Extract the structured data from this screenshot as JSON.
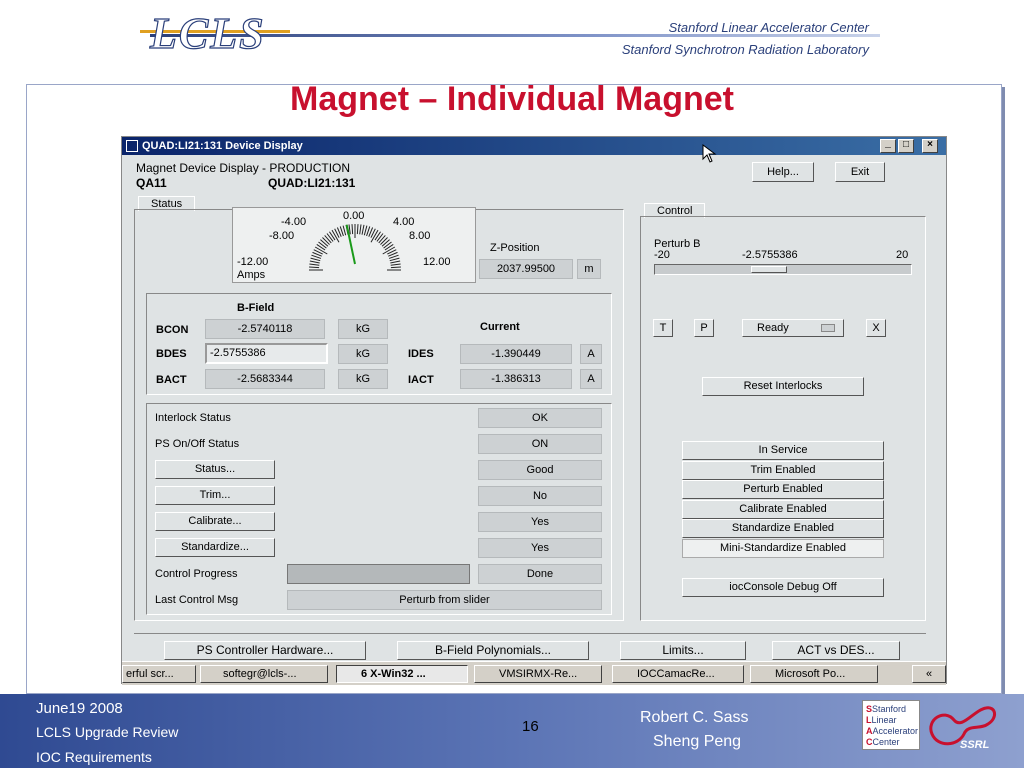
{
  "header": {
    "logo": "LCLS",
    "org1": "Stanford Linear Accelerator Center",
    "org2": "Stanford Synchrotron Radiation Laboratory"
  },
  "slide_title": "Magnet – Individual Magnet",
  "window": {
    "title": "QUAD:LI21:131 Device Display",
    "minimize": "_",
    "maximize": "□",
    "close": "×",
    "subtitle": "Magnet Device Display  -  PRODUCTION",
    "device_short": "QA11",
    "device_name": "QUAD:LI21:131",
    "help_button": "Help...",
    "exit_button": "Exit"
  },
  "status_tab": {
    "tab_label": "Status",
    "meter": {
      "ticks": [
        "-4.00",
        "0.00",
        "4.00",
        "-8.00",
        "8.00",
        "-12.00",
        "12.00"
      ],
      "units": "Amps",
      "needle_value": -1.39
    },
    "z_position_label": "Z-Position",
    "z_position_value": "2037.99500",
    "z_position_unit": "m",
    "bfield_title": "B-Field",
    "current_title": "Current",
    "bcon_label": "BCON",
    "bcon_value": "-2.5740118",
    "bcon_unit": "kG",
    "bdes_label": "BDES",
    "bdes_value": "-2.5755386",
    "bdes_unit": "kG",
    "bact_label": "BACT",
    "bact_value": "-2.5683344",
    "bact_unit": "kG",
    "ides_label": "IDES",
    "ides_value": "-1.390449",
    "ides_unit": "A",
    "iact_label": "IACT",
    "iact_value": "-1.386313",
    "iact_unit": "A",
    "interlock_label": "Interlock Status",
    "interlock_value": "OK",
    "ps_label": "PS On/Off Status",
    "ps_value": "ON",
    "status_button": "Status...",
    "status_value": "Good",
    "trim_button": "Trim...",
    "trim_value": "No",
    "calibrate_button": "Calibrate...",
    "calibrate_value": "Yes",
    "standardize_button": "Standardize...",
    "standardize_value": "Yes",
    "progress_label": "Control Progress",
    "progress_value": "Done",
    "lastmsg_label": "Last Control Msg",
    "lastmsg_value": "Perturb from slider"
  },
  "control_tab": {
    "tab_label": "Control",
    "perturb_label": "Perturb B",
    "perturb_min": "-20",
    "perturb_value": "-2.5755386",
    "perturb_max": "20",
    "slider_value": -2.5755386,
    "slider_min": -20,
    "slider_max": 20,
    "t_button": "T",
    "p_button": "P",
    "ready_button": "Ready",
    "x_button": "X",
    "reset_button": "Reset Interlocks",
    "flags": [
      "In Service",
      "Trim Enabled",
      "Perturb Enabled",
      "Calibrate Enabled",
      "Standardize Enabled",
      "Mini-Standardize Enabled"
    ],
    "debug_button": "iocConsole Debug Off"
  },
  "bottom_buttons": [
    "PS Controller Hardware...",
    "B-Field Polynomials...",
    "Limits...",
    "ACT vs DES..."
  ],
  "taskbar": [
    "erful scr...",
    "softegr@lcls-...",
    "6 X-Win32 ...",
    "VMSIRMX-Re...",
    "IOCCamacRe...",
    "Microsoft Po...",
    "«"
  ],
  "footer": {
    "date": "June19 2008",
    "line2": "LCLS Upgrade Review",
    "line3": "IOC Requirements",
    "page": "16",
    "author1": "Robert C. Sass",
    "author2": "Sheng Peng",
    "logo_lines": [
      "Stanford",
      "Linear",
      "Accelerator",
      "Center"
    ],
    "ssrl": "SSRL"
  },
  "colors": {
    "title_red": "#c8102e",
    "footer_blue": "#2f4a92",
    "window_bg": "#dfe3e4",
    "needle_green": "#1a9a1a"
  }
}
